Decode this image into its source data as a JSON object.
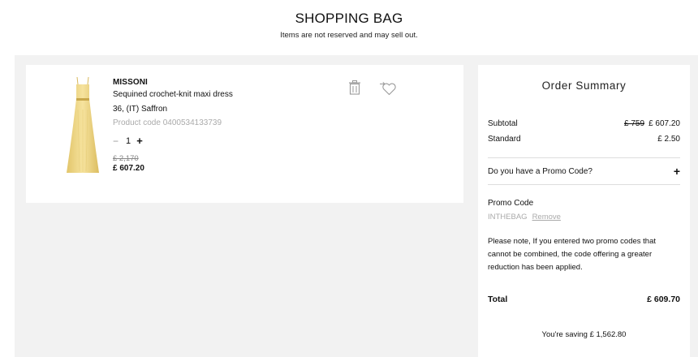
{
  "header": {
    "title": "SHOPPING BAG",
    "subtitle": "Items are not reserved and may sell out."
  },
  "item": {
    "brand": "MISSONI",
    "name": "Sequined crochet-knit maxi dress",
    "size_color": "36, (IT) Saffron",
    "product_code": "Product code 0400534133739",
    "qty_minus": "−",
    "quantity": "1",
    "qty_plus": "+",
    "original_price": "£ 2,170",
    "price": "£ 607.20",
    "image_icon": "dress-product-image",
    "actions": {
      "delete_icon": "trash-icon",
      "wishlist_icon": "move-to-wishlist-icon"
    }
  },
  "summary": {
    "title": "Order Summary",
    "subtotal_label": "Subtotal",
    "subtotal_old": "£ 759",
    "subtotal_value": "£ 607.20",
    "shipping_label": "Standard",
    "shipping_value": "£ 2.50",
    "promo_question": "Do you have a Promo Code?",
    "promo_toggle": "+",
    "promo_label": "Promo Code",
    "promo_code": "INTHEBAG",
    "promo_remove": "Remove",
    "note": "Please note, If you entered two promo codes that cannot be combined, the code offering a greater reduction has been applied.",
    "total_label": "Total",
    "total_value": "£ 609.70",
    "saving": "You're saving £ 1,562.80"
  },
  "colors": {
    "background_gray": "#f2f2f2",
    "dress_yellow": "#f0d98a",
    "muted_text": "#aaaaaa"
  }
}
